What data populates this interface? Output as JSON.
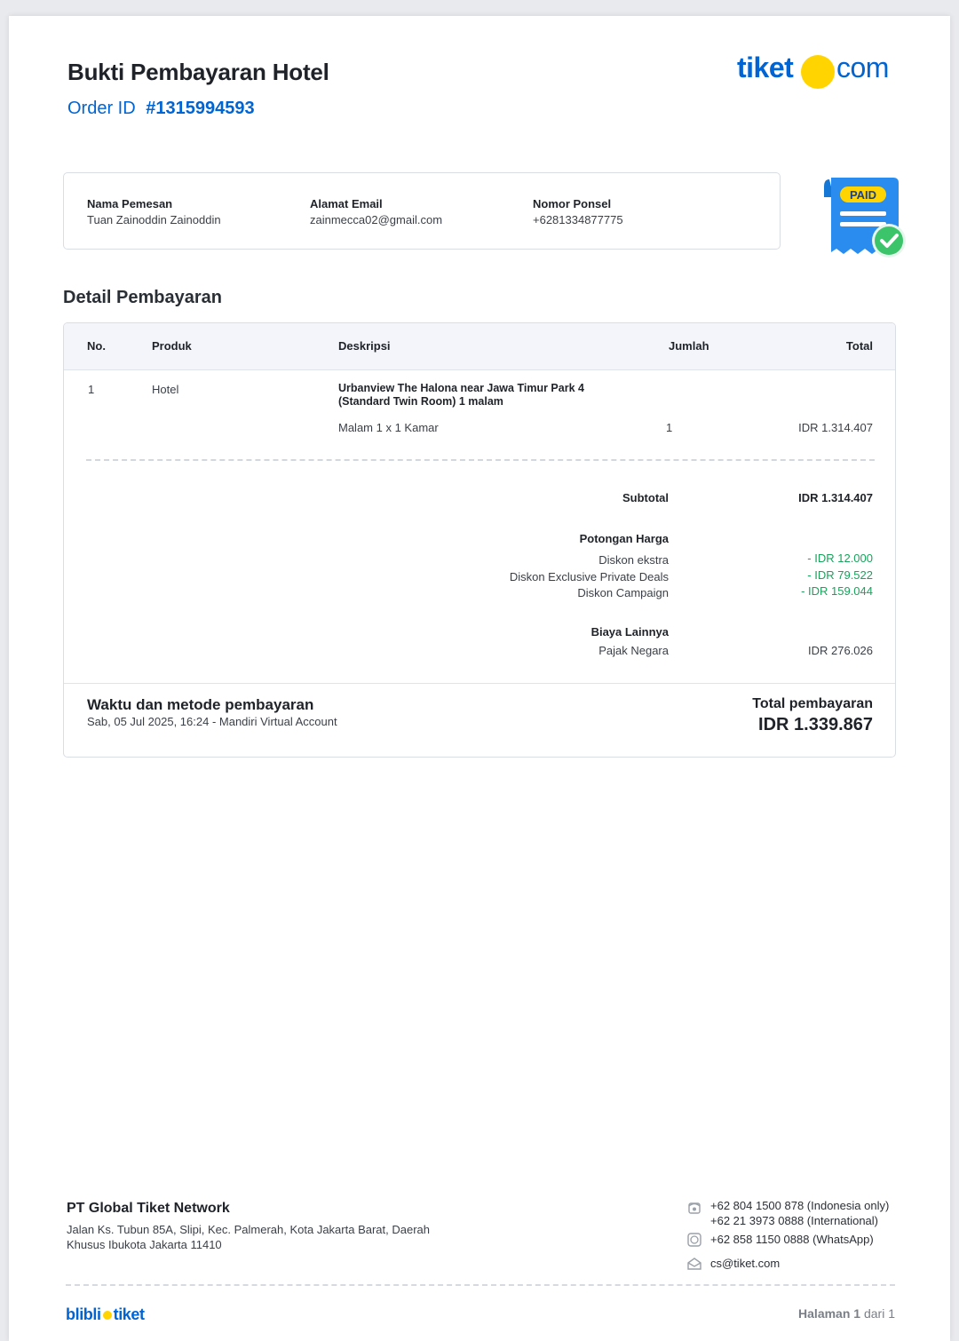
{
  "header": {
    "title": "Bukti Pembayaran Hotel",
    "order_label": "Order ID",
    "order_number": "#1315994593",
    "logo_left": "tiket",
    "logo_right": "com"
  },
  "customer": {
    "name_label": "Nama Pemesan",
    "name_value": "Tuan Zainoddin Zainoddin",
    "email_label": "Alamat Email",
    "email_value": "zainmecca02@gmail.com",
    "phone_label": "Nomor Ponsel",
    "phone_value": "+6281334877775"
  },
  "paid_badge": "PAID",
  "details": {
    "section_title": "Detail Pembayaran",
    "columns": {
      "no": "No.",
      "product": "Produk",
      "description": "Deskripsi",
      "quantity": "Jumlah",
      "total": "Total"
    },
    "row": {
      "no": "1",
      "product": "Hotel",
      "description_line1": "Urbanview The Halona near Jawa Timur Park 4",
      "description_line2": "(Standard Twin Room) 1 malam",
      "detail": "Malam 1 x 1 Kamar",
      "quantity": "1",
      "total": "IDR 1.314.407"
    },
    "subtotal_label": "Subtotal",
    "subtotal_value": "IDR 1.314.407",
    "discount_title": "Potongan Harga",
    "discounts": [
      {
        "label": "Diskon ekstra",
        "value": "- IDR 12.000"
      },
      {
        "label": "Diskon Exclusive Private Deals",
        "value": "- IDR 79.522"
      },
      {
        "label": "Diskon Campaign",
        "value": "- IDR 159.044"
      }
    ],
    "other_title": "Biaya Lainnya",
    "tax_label": "Pajak Negara",
    "tax_value": "IDR 276.026",
    "payment_title": "Waktu dan metode pembayaran",
    "payment_detail": "Sab, 05 Jul 2025, 16:24 - Mandiri Virtual Account",
    "total_label": "Total pembayaran",
    "total_value": "IDR 1.339.867"
  },
  "footer": {
    "company": "PT Global Tiket Network",
    "address_line1": "Jalan Ks. Tubun 85A, Slipi, Kec. Palmerah, Kota Jakarta Barat, Daerah",
    "address_line2": "Khusus Ibukota Jakarta 11410",
    "phone_local": "+62 804 1500 878 (Indonesia only)",
    "phone_intl": "+62 21 3973 0888 (International)",
    "whatsapp": "+62 858 1150 0888 (WhatsApp)",
    "email": "cs@tiket.com",
    "brand_left": "blibli",
    "brand_right": "tiket",
    "page_word": "Halaman",
    "page_current": "1",
    "page_of": "dari 1"
  },
  "colors": {
    "brand_blue": "#0064d2",
    "brand_yellow": "#ffd400",
    "discount_green": "#1aa25c",
    "paid_check": "#3cc46b"
  },
  "icons": [
    "phone-icon",
    "whatsapp-icon",
    "mail-icon",
    "paid-receipt-icon",
    "check-icon"
  ]
}
